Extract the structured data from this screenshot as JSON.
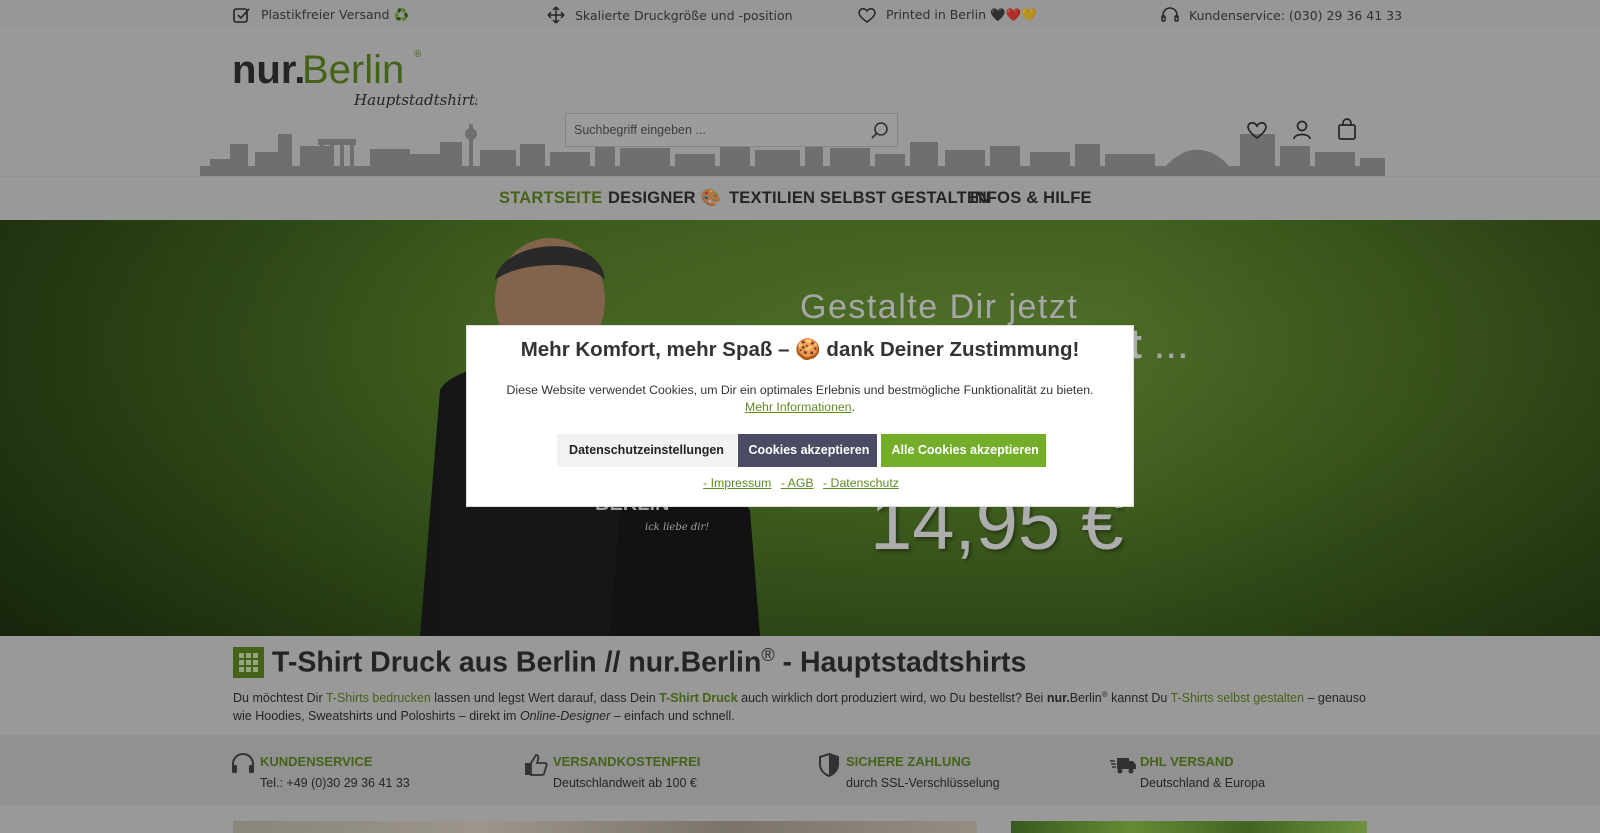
{
  "topbar": {
    "items": [
      {
        "label": "Plastikfreier Versand ♻️",
        "icon": "checklist-icon"
      },
      {
        "label": "Skalierte Druckgröße und -position",
        "icon": "move-arrows-icon"
      },
      {
        "label": "Printed in Berlin 🖤❤️💛",
        "icon": "heart-icon"
      },
      {
        "label": "Kundenservice: (030) 29 36 41 33",
        "icon": "headset-icon"
      }
    ]
  },
  "header": {
    "logo_main": "nur.Berlin",
    "logo_reg": "®",
    "logo_sub": "Hauptstadtshirts",
    "search_placeholder": "Suchbegriff eingeben ..."
  },
  "nav": {
    "items": [
      {
        "label": "STARTSEITE",
        "active": true
      },
      {
        "label": "DESIGNER 🎨",
        "active": false
      },
      {
        "label": "TEXTILIEN SELBST GESTALTEN",
        "active": false
      },
      {
        "label": "INFOS & HILFE",
        "active": false
      }
    ]
  },
  "hero": {
    "line1": "Gestalte Dir jetzt",
    "line2": "irt",
    "line2_dots": " ...",
    "price": "14,95 €"
  },
  "cookie": {
    "title": "Mehr Komfort, mehr Spaß – 🍪 dank Deiner Zustimmung!",
    "text": "Diese Website verwendet Cookies, um Dir ein optimales Erlebnis und bestmögliche Funktionalität zu bieten.",
    "more_link": "Mehr Informationen",
    "text_end": ".",
    "btn_settings": "Datenschutzeinstellungen",
    "btn_accept": "Cookies akzeptieren",
    "btn_accept_all": "Alle Cookies akzeptieren",
    "link_impressum": "- Impressum",
    "link_agb": "- AGB",
    "link_datenschutz": "- Datenschutz"
  },
  "intro": {
    "title_a": "T-Shirt Druck aus Berlin // nur.Berlin",
    "title_reg": "®",
    "title_b": " - Hauptstadtshirts",
    "t1": "Du möchtest Dir ",
    "l1": "T-Shirts bedrucken",
    "t2": " lassen und legst Wert darauf, dass Dein ",
    "l2": "T-Shirt Druck",
    "t3": " auch wirklich dort produziert wird, wo Du bestellst? Bei ",
    "brand_bold": "nur.",
    "brand_rest": "Berlin",
    "brand_reg": "®",
    "t4": " kannst Du ",
    "l3": "T-Shirts selbst gestalten",
    "t5": " – genauso wie Hoodies, Sweatshirts und Poloshirts – direkt im ",
    "italic": "Online-Designer",
    "t6": " – einfach und schnell."
  },
  "usps": [
    {
      "title": "KUNDENSERVICE",
      "sub": "Tel.: +49 (0)30 29 36 41 33",
      "icon": "headset-icon"
    },
    {
      "title": "VERSANDKOSTENFREI",
      "sub": "Deutschlandweit ab 100 €",
      "icon": "thumbs-up-icon"
    },
    {
      "title": "SICHERE ZAHLUNG",
      "sub": "durch SSL-Verschlüsselung",
      "icon": "shield-icon"
    },
    {
      "title": "DHL VERSAND",
      "sub": "Deutschland & Europa",
      "icon": "truck-icon"
    }
  ],
  "colors": {
    "accent_green": "#5f8a22",
    "button_dark": "#4b4c63",
    "button_green": "#74ad2a"
  }
}
